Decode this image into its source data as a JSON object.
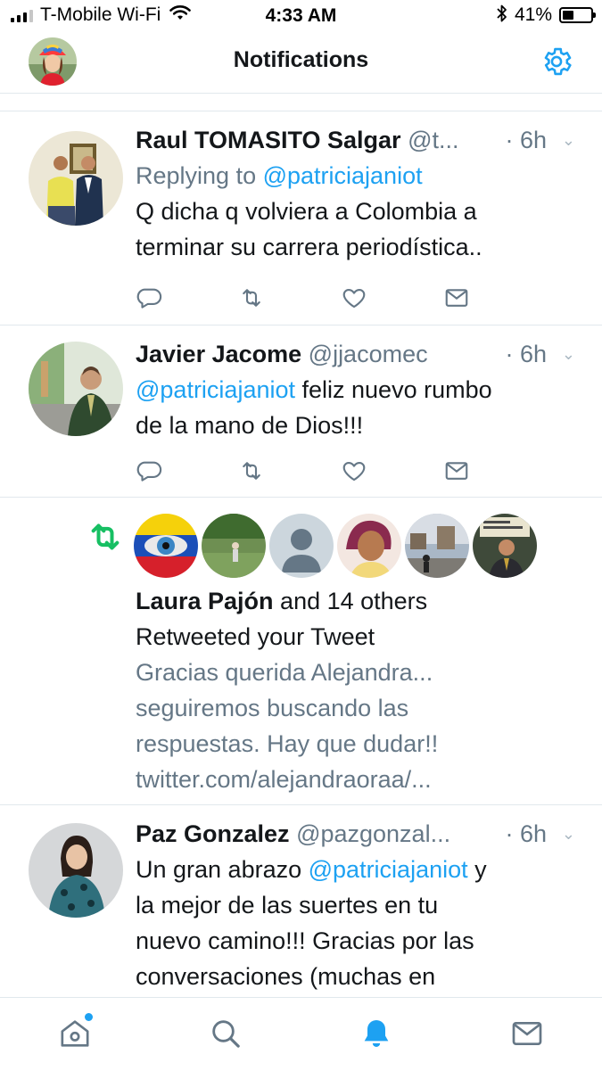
{
  "status_bar": {
    "carrier": "T-Mobile Wi-Fi",
    "time": "4:33 AM",
    "battery": "41%",
    "battery_level": 0.41
  },
  "nav": {
    "title": "Notifications",
    "avatar_icon": "profile-avatar",
    "settings_icon": "gear-icon"
  },
  "tweets": [
    {
      "name": "Raul TOMASITO Salgar",
      "handle": "@t...",
      "time": "· 6h",
      "reply_prefix": "Replying to ",
      "reply_to": "@patriciajaniot",
      "lines": [
        "Q dicha q volviera a Colombia a",
        "terminar su carrera periodística.."
      ]
    },
    {
      "name": "Javier Jacome",
      "handle": "@jjacomec",
      "time": "· 6h",
      "mention": "@patriciajaniot",
      "line1_rest": " feliz nuevo rumbo",
      "line2": "de la mano de Dios!!!"
    },
    {
      "name": "Paz Gonzalez",
      "handle": "@pazgonzal...",
      "time": "· 6h",
      "line1_prefix": "Un gran abrazo ",
      "mention": "@patriciajaniot",
      "line1_suffix": " y",
      "lines": [
        "la mejor de las suertes en tu",
        "nuevo camino!!! Gracias por las",
        "conversaciones (muchas en"
      ]
    }
  ],
  "retweet_notification": {
    "actor": "Laura Pajón",
    "others": " and 14 others",
    "action": "Retweeted your Tweet",
    "quoted_lines": [
      "Gracias querida Alejandra...",
      "seguiremos buscando las",
      "respuestas. Hay que dudar!!",
      "twitter.com/alejandraoraa/..."
    ]
  },
  "tab_bar": {
    "items": [
      "home-icon",
      "search-icon",
      "notifications-bell-icon",
      "messages-icon"
    ],
    "active": "notifications-bell-icon"
  },
  "colors": {
    "accent": "#1da1f2",
    "retweet_green": "#17bf63",
    "text": "#14171a",
    "muted": "#657786",
    "divider": "#e1e8ed"
  }
}
